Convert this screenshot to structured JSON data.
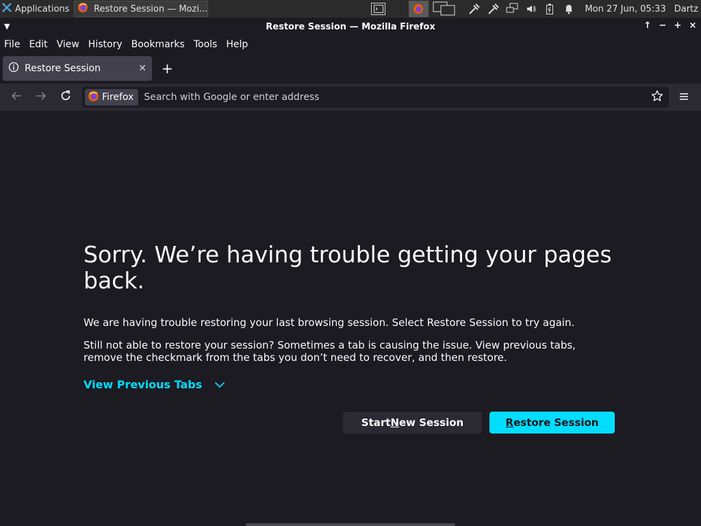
{
  "panel": {
    "applications_label": "Applications",
    "task_label": "Restore Session — Mozi...",
    "clock": "Mon 27 Jun, 05:33",
    "user": "Dartz"
  },
  "window": {
    "title": "Restore Session — Mozilla Firefox",
    "controls": [
      "↑",
      "−",
      "+",
      "×"
    ]
  },
  "menubar": {
    "items": [
      "File",
      "Edit",
      "View",
      "History",
      "Bookmarks",
      "Tools",
      "Help"
    ]
  },
  "tab": {
    "title": "Restore Session",
    "new_tab_label": "+"
  },
  "navbar": {
    "identity_label": "Firefox",
    "url_placeholder": "Search with Google or enter address"
  },
  "page": {
    "title": "Sorry. We’re having trouble getting your pages back.",
    "para1": "We are having trouble restoring your last browsing session. Select Restore Session to try again.",
    "para2": "Still not able to restore your session? Sometimes a tab is causing the issue. View previous tabs, remove the checkmark from the tabs you don’t need to recover, and then restore.",
    "view_previous_tabs": "View Previous Tabs",
    "start_new_pre": "Start ",
    "start_new_acc": "N",
    "start_new_post": "ew Session",
    "restore_acc": "R",
    "restore_post": "estore Session"
  },
  "colors": {
    "background": "#1c1b22",
    "toolbar": "#2b2a33",
    "accent": "#00ddff",
    "tab_selected": "#42414d"
  },
  "icons": [
    "xfce-apps-icon",
    "firefox-icon",
    "terminal-icon",
    "window-switch-icon",
    "network-icon",
    "volume-icon",
    "battery-icon",
    "bell-icon",
    "info-icon",
    "back-arrow-icon",
    "forward-arrow-icon",
    "reload-icon",
    "star-icon",
    "hamburger-menu-icon",
    "chevron-down-icon"
  ]
}
